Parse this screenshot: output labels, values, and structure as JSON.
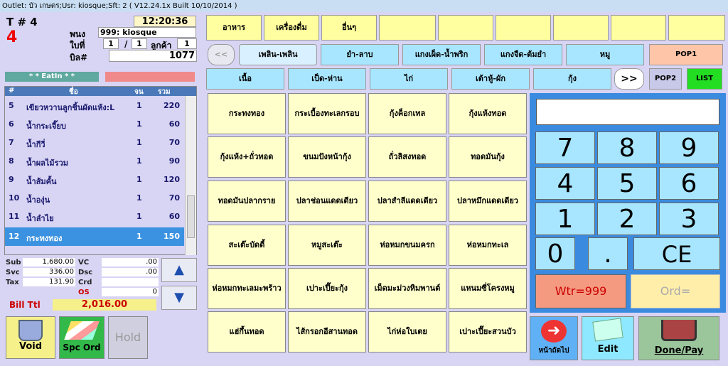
{
  "titlebar": "Outlet: บัว เกษตร;Usr: kiosque;Sft: 2 ( V12.24.1x Built 10/10/2014 )",
  "header": {
    "table_label": "T # 4",
    "table_number": "4",
    "time": "12:20:36",
    "staff_label": "พนง",
    "staff_value": "999: kiosque",
    "bill_part_label": "ใบที่",
    "bill_part_num": "1",
    "bill_part_sep": "/",
    "bill_part_total": "1",
    "customers_label": "ลูกค้า",
    "customers_value": "1",
    "bill_no_label": "บิล#",
    "bill_no_value": "1077",
    "eatin": "* * EatIn * *"
  },
  "order_list": {
    "columns": [
      "#",
      "ชื่อ",
      "จน",
      "รวม"
    ],
    "rows": [
      {
        "no": "5",
        "name": "เขียวหวานลูกชิ้นผัดแห้ง:L",
        "qty": "1",
        "total": "220"
      },
      {
        "no": "6",
        "name": "น้ำกระเจี๊ยบ",
        "qty": "1",
        "total": "60"
      },
      {
        "no": "7",
        "name": "น้ำกีวี่",
        "qty": "1",
        "total": "70"
      },
      {
        "no": "8",
        "name": "น้ำผลไม้รวม",
        "qty": "1",
        "total": "90"
      },
      {
        "no": "9",
        "name": "น้ำส้มคั้น",
        "qty": "1",
        "total": "120"
      },
      {
        "no": "10",
        "name": "น้ำองุ่น",
        "qty": "1",
        "total": "70"
      },
      {
        "no": "11",
        "name": "น้ำลำไย",
        "qty": "1",
        "total": "60"
      },
      {
        "no": "12",
        "name": "กระทงทอง",
        "qty": "1",
        "total": "150"
      }
    ]
  },
  "totals": {
    "sub_label": "Sub",
    "sub": "1,680.00",
    "svc_label": "Svc",
    "svc": "336.00",
    "tax_label": "Tax",
    "tax": "131.90",
    "vc_label": "VC",
    "vc": ".00",
    "dsc_label": "Dsc",
    "dsc": ".00",
    "crd_label": "Crd",
    "crd": "",
    "os_label": "OS",
    "os": "0",
    "bill_total_label": "Bill Ttl",
    "bill_total": "2,016.00"
  },
  "bottom_left": {
    "void": "Void",
    "spc_ord": "Spc Ord",
    "hold": "Hold"
  },
  "categories": [
    "อาหาร",
    "เครื่องดื่ม",
    "อื่นๆ",
    "",
    "",
    "",
    "",
    "",
    "",
    ""
  ],
  "subcats_row1": [
    "<<",
    "เพลิน-เพลิน",
    "ยำ-ลาบ",
    "แกงเผ็ด-น้ำพริก",
    "แกงจืด-ต้มยำ",
    "หมู",
    "POP1"
  ],
  "subcats_row2": [
    "เนื้อ",
    "เป็ด-ห่าน",
    "ไก่",
    "เต้าหู้-ผัก",
    "กุ้ง",
    ">>",
    "POP2",
    "LIST"
  ],
  "items": [
    "กระทงทอง",
    "กระเบื้องทะเลกรอบ",
    "กุ้งค็อกเทล",
    "กุ้งแห้งทอด",
    "กุ้งแห้ง+ถั่วทอด",
    "ขนมปังหน้ากุ้ง",
    "ถั่วลิสงทอด",
    "ทอดมันกุ้ง",
    "ทอดมันปลากราย",
    "ปลาช่อนแดดเดียว",
    "ปลาสำลีแดดเดียว",
    "ปลาหมึกแดดเดียว",
    "สะเต๊ะบัดดี้",
    "หมูสะเต๊ะ",
    "ห่อหมกขนมครก",
    "ห่อหมกทะเล",
    "ห่อหมกทะเลมะพร้าว",
    "เปาะเปี๊ยะกุ้ง",
    "เม็ดมะม่วงหิมพานต์",
    "แหนมซี่โครงหมู",
    "แฮ่กึ้นทอด",
    "ไส้กรอกอีสานทอด",
    "ไก่ห่อใบเตย",
    "เปาะเปี๊ยะสวนบัว"
  ],
  "keypad": {
    "keys": [
      "7",
      "8",
      "9",
      "4",
      "5",
      "6",
      "1",
      "2",
      "3",
      "0",
      "."
    ],
    "ce": "CE",
    "wtr": "Wtr=999",
    "ord": "Ord="
  },
  "footer": {
    "next_page": "หน้าถัดไป",
    "edit": "Edit",
    "done_pay": "Done/Pay"
  }
}
